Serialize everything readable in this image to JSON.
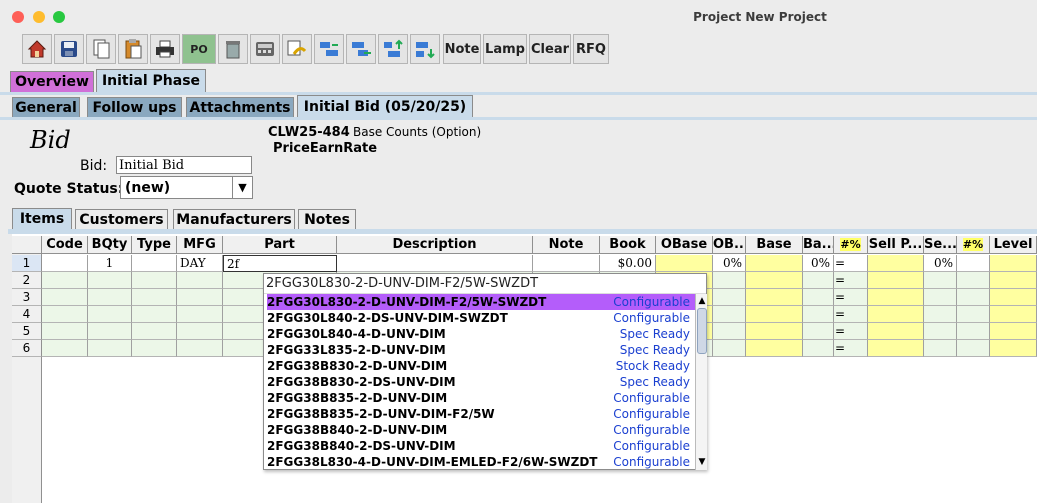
{
  "window": {
    "title": "Project New Project"
  },
  "toolbar": {
    "icons": [
      "home-icon",
      "save-icon",
      "copy-icon",
      "paste-icon",
      "print-icon",
      "po-icon",
      "delete-icon",
      "calculator-icon",
      "undo-icon",
      "shift-left-icon",
      "shift-right-icon",
      "move-up-icon",
      "move-down-icon"
    ],
    "po_label": "PO",
    "note_label": "Note",
    "lamp_label": "Lamp",
    "clear_label": "Clear",
    "rfq_label": "RFQ"
  },
  "phase_tabs": [
    {
      "label": "Overview"
    },
    {
      "label": "Initial Phase"
    }
  ],
  "sub_tabs": [
    {
      "label": "General"
    },
    {
      "label": "Follow ups"
    },
    {
      "label": "Attachments"
    },
    {
      "label": "Initial Bid (05/20/25)"
    }
  ],
  "bid": {
    "heading": "Bid",
    "bid_label": "Bid:",
    "bid_value": "Initial Bid",
    "quote_status_label": "Quote Status:",
    "quote_status_value": "(new)",
    "code": "CLW25-484",
    "base_counts": "Base Counts (Option)",
    "price_earn_rate": "PriceEarnRate"
  },
  "inner_tabs": [
    {
      "label": "Items"
    },
    {
      "label": "Customers"
    },
    {
      "label": "Manufacturers"
    },
    {
      "label": "Notes"
    }
  ],
  "table": {
    "columns": [
      "Code",
      "BQty",
      "Type",
      "MFG",
      "Part",
      "Description",
      "Note",
      "Book",
      "OBase",
      "OB...",
      "Base",
      "Ba...",
      "#%",
      "Sell P...",
      "Se...",
      "#%",
      "Level"
    ],
    "rows": [
      {
        "num": "1",
        "code": "",
        "bqty": "1",
        "type": "",
        "mfg": "DAY",
        "part": "2f",
        "description": "",
        "note": "",
        "book": "$0.00",
        "obase": "",
        "ob": "0%",
        "base": "",
        "ba": "0%",
        "pct": "=",
        "sell": "",
        "se": "0%"
      },
      {
        "num": "2",
        "pct": "="
      },
      {
        "num": "3",
        "pct": "="
      },
      {
        "num": "4",
        "pct": "="
      },
      {
        "num": "5",
        "pct": "="
      },
      {
        "num": "6",
        "pct": "="
      }
    ]
  },
  "autocomplete": {
    "query": "2FGG30L830-2-D-UNV-DIM-F2/5W-SWZDT",
    "items": [
      {
        "part": "2FGG30L830-2-D-UNV-DIM-F2/5W-SWZDT",
        "status": "Configurable",
        "selected": true
      },
      {
        "part": "2FGG30L840-2-DS-UNV-DIM-SWZDT",
        "status": "Configurable"
      },
      {
        "part": "2FGG30L840-4-D-UNV-DIM",
        "status": "Spec Ready"
      },
      {
        "part": "2FGG33L835-2-D-UNV-DIM",
        "status": "Spec Ready"
      },
      {
        "part": "2FGG38B830-2-D-UNV-DIM",
        "status": "Stock Ready"
      },
      {
        "part": "2FGG38B830-2-DS-UNV-DIM",
        "status": "Spec Ready"
      },
      {
        "part": "2FGG38B835-2-D-UNV-DIM",
        "status": "Configurable"
      },
      {
        "part": "2FGG38B835-2-D-UNV-DIM-F2/5W",
        "status": "Configurable"
      },
      {
        "part": "2FGG38B840-2-D-UNV-DIM",
        "status": "Configurable"
      },
      {
        "part": "2FGG38B840-2-DS-UNV-DIM",
        "status": "Configurable"
      },
      {
        "part": "2FGG38L830-4-D-UNV-DIM-EMLED-F2/6W-SWZDT",
        "status": "Configurable"
      }
    ]
  },
  "colors": {
    "overview_tab": "#d070d8",
    "active_tab": "#c9dbea",
    "inactive_tab": "#8aa8bf",
    "yellow_cell": "#ffffa0",
    "green_row": "#ecf7e8",
    "selection": "#b45dfa",
    "status_link": "#1a3fd0"
  }
}
